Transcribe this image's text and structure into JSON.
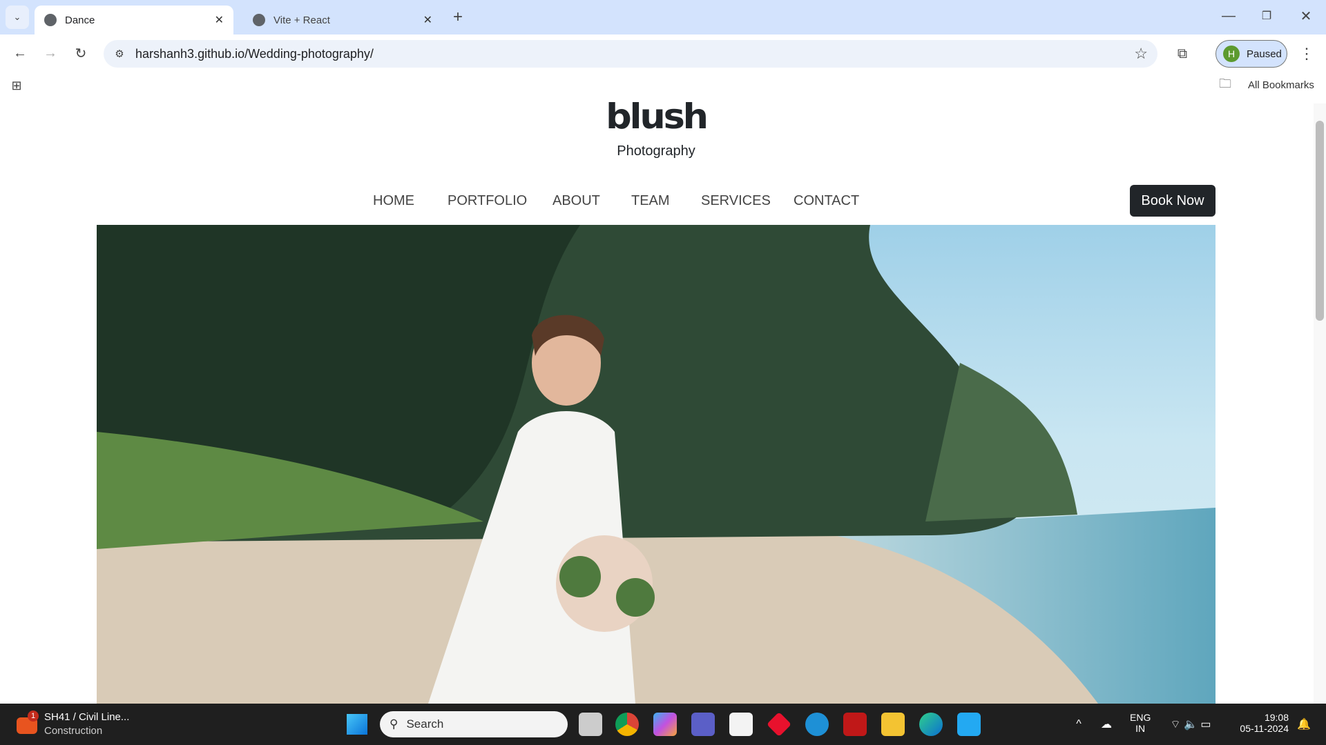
{
  "browser": {
    "tabs": [
      {
        "title": "Dance",
        "active": true
      },
      {
        "title": "Vite + React",
        "active": false
      }
    ],
    "url": "harshanh3.github.io/Wedding-photography/",
    "profile": {
      "initial": "H",
      "label": "Paused"
    },
    "bookmarks_label": "All Bookmarks"
  },
  "site": {
    "logo": "blush",
    "tagline": "Photography",
    "nav": [
      "HOME",
      "PORTFOLIO",
      "ABOUT",
      "TEAM",
      "SERVICES",
      "CONTACT"
    ],
    "book_label": "Book Now"
  },
  "taskbar": {
    "weather_badge": "1",
    "weather_title": "SH41 / Civil Line...",
    "weather_sub": "Construction",
    "search_placeholder": "Search",
    "lang1": "ENG",
    "lang2": "IN",
    "time": "19:08",
    "date": "05-11-2024"
  }
}
